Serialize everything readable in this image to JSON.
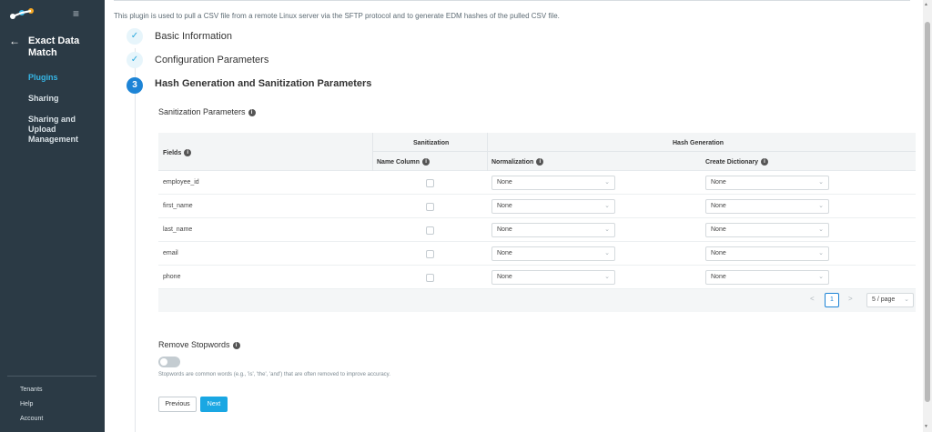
{
  "sidebar": {
    "back_label": "←",
    "title": "Exact Data Match",
    "nav": [
      {
        "label": "Plugins"
      },
      {
        "label": "Sharing"
      },
      {
        "label": "Sharing and Upload Management"
      }
    ],
    "footer": [
      {
        "label": "Tenants"
      },
      {
        "label": "Help"
      },
      {
        "label": "Account"
      }
    ]
  },
  "main": {
    "description": "This plugin is used to pull a CSV file from a remote Linux server via the SFTP protocol and to generate EDM hashes of the pulled CSV file.",
    "steps": [
      {
        "label": "Basic Information",
        "status": "done",
        "icon": "✓"
      },
      {
        "label": "Configuration Parameters",
        "status": "done",
        "icon": "✓"
      },
      {
        "label": "Hash Generation and Sanitization Parameters",
        "status": "current",
        "icon": "3"
      }
    ],
    "sanitization_title": "Sanitization Parameters",
    "table": {
      "fields_header": "Fields",
      "sanitization_header": "Sanitization",
      "hash_header": "Hash Generation",
      "name_column_header": "Name Column",
      "normalization_header": "Normalization",
      "dictionary_header": "Create Dictionary",
      "rows": [
        {
          "field": "employee_id",
          "normalization": "None",
          "dictionary": "None"
        },
        {
          "field": "first_name",
          "normalization": "None",
          "dictionary": "None"
        },
        {
          "field": "last_name",
          "normalization": "None",
          "dictionary": "None"
        },
        {
          "field": "email",
          "normalization": "None",
          "dictionary": "None"
        },
        {
          "field": "phone",
          "normalization": "None",
          "dictionary": "None"
        }
      ]
    },
    "pagination": {
      "prev": "<",
      "page": "1",
      "next": ">",
      "page_size": "5 / page"
    },
    "stopwords_title": "Remove Stopwords",
    "stopwords_desc": "Stopwords are common words (e.g., 'is', 'the', 'and') that are often removed to improve accuracy.",
    "stopwords_enabled": false,
    "buttons": {
      "previous": "Previous",
      "next": "Next"
    }
  },
  "colors": {
    "accent": "#1aa7e3",
    "sidebar_bg": "#2b3a45",
    "active_nav": "#36b6e6"
  }
}
